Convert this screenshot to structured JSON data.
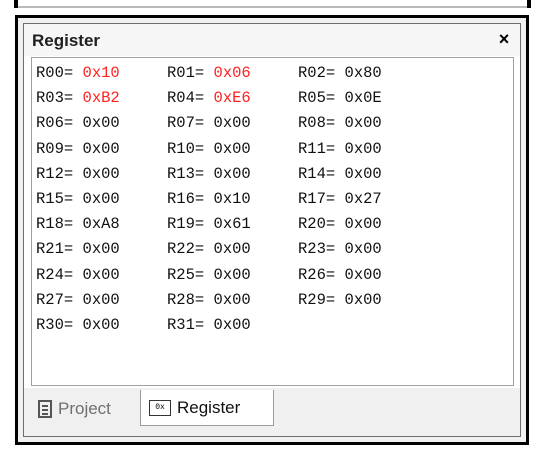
{
  "panel": {
    "title": "Register",
    "close_glyph": "×"
  },
  "registers": [
    [
      {
        "name": "R00=",
        "value": "0x10",
        "changed": true
      },
      {
        "name": "R01=",
        "value": "0x06",
        "changed": true
      },
      {
        "name": "R02=",
        "value": "0x80",
        "changed": false
      }
    ],
    [
      {
        "name": "R03=",
        "value": "0xB2",
        "changed": true
      },
      {
        "name": "R04=",
        "value": "0xE6",
        "changed": true
      },
      {
        "name": "R05=",
        "value": "0x0E",
        "changed": false
      }
    ],
    [
      {
        "name": "R06=",
        "value": "0x00",
        "changed": false
      },
      {
        "name": "R07=",
        "value": "0x00",
        "changed": false
      },
      {
        "name": "R08=",
        "value": "0x00",
        "changed": false
      }
    ],
    [
      {
        "name": "R09=",
        "value": "0x00",
        "changed": false
      },
      {
        "name": "R10=",
        "value": "0x00",
        "changed": false
      },
      {
        "name": "R11=",
        "value": "0x00",
        "changed": false
      }
    ],
    [
      {
        "name": "R12=",
        "value": "0x00",
        "changed": false
      },
      {
        "name": "R13=",
        "value": "0x00",
        "changed": false
      },
      {
        "name": "R14=",
        "value": "0x00",
        "changed": false
      }
    ],
    [
      {
        "name": "R15=",
        "value": "0x00",
        "changed": false
      },
      {
        "name": "R16=",
        "value": "0x10",
        "changed": false
      },
      {
        "name": "R17=",
        "value": "0x27",
        "changed": false
      }
    ],
    [
      {
        "name": "R18=",
        "value": "0xA8",
        "changed": false
      },
      {
        "name": "R19=",
        "value": "0x61",
        "changed": false
      },
      {
        "name": "R20=",
        "value": "0x00",
        "changed": false
      }
    ],
    [
      {
        "name": "R21=",
        "value": "0x00",
        "changed": false
      },
      {
        "name": "R22=",
        "value": "0x00",
        "changed": false
      },
      {
        "name": "R23=",
        "value": "0x00",
        "changed": false
      }
    ],
    [
      {
        "name": "R24=",
        "value": "0x00",
        "changed": false
      },
      {
        "name": "R25=",
        "value": "0x00",
        "changed": false
      },
      {
        "name": "R26=",
        "value": "0x00",
        "changed": false
      }
    ],
    [
      {
        "name": "R27=",
        "value": "0x00",
        "changed": false
      },
      {
        "name": "R28=",
        "value": "0x00",
        "changed": false
      },
      {
        "name": "R29=",
        "value": "0x00",
        "changed": false
      }
    ],
    [
      {
        "name": "R30=",
        "value": "0x00",
        "changed": false
      },
      {
        "name": "R31=",
        "value": "0x00",
        "changed": false
      }
    ]
  ],
  "tabs": [
    {
      "label": "Project",
      "icon": "document-icon",
      "active": false
    },
    {
      "label": "Register",
      "icon": "register-icon",
      "icon_text": "0x",
      "active": true
    }
  ],
  "colors": {
    "changed_value": "#ff2020",
    "normal_value": "#101010"
  }
}
